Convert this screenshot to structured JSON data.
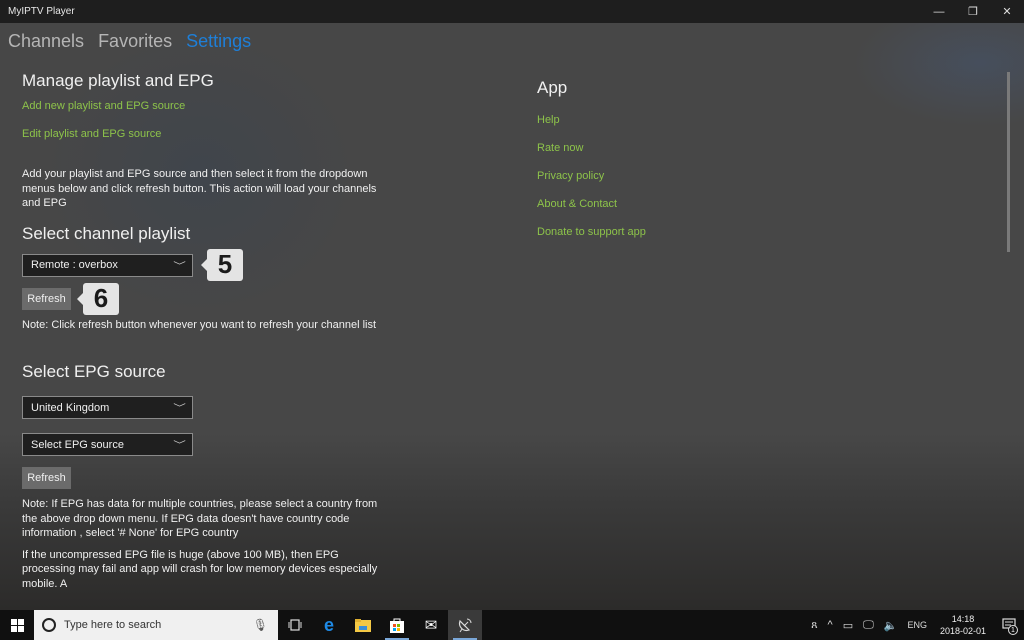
{
  "window": {
    "title": "MyIPTV Player",
    "controls": {
      "minimize": "—",
      "maximize": "❐",
      "close": "✕"
    }
  },
  "nav": {
    "tabs": [
      {
        "label": "Channels",
        "active": false
      },
      {
        "label": "Favorites",
        "active": false
      },
      {
        "label": "Settings",
        "active": true
      }
    ]
  },
  "manage": {
    "title": "Manage playlist and EPG",
    "links": [
      "Add new playlist and EPG source",
      "Edit playlist and EPG source"
    ],
    "description": "Add your playlist and EPG source and then select it from the dropdown menus below and click refresh button. This action will load your channels and EPG"
  },
  "channel_playlist": {
    "title": "Select channel playlist",
    "dropdown_value": "Remote : overbox",
    "refresh_label": "Refresh",
    "note": "Note: Click refresh button whenever you want to refresh your channel list",
    "callouts": [
      "5",
      "6"
    ]
  },
  "epg": {
    "title": "Select EPG source",
    "country_value": "United Kingdom",
    "source_value": "Select EPG source",
    "refresh_label": "Refresh",
    "note1": "Note:  If EPG has data for multiple countries, please select a country from the above drop down menu. If EPG  data doesn't have country code information , select '# None' for EPG country",
    "note2": "If the uncompressed EPG file is huge (above 100 MB), then EPG processing may fail and app will crash for low memory devices especially mobile. A"
  },
  "app": {
    "title": "App",
    "links": [
      "Help",
      "Rate now",
      "Privacy policy",
      "About & Contact",
      "Donate to support app"
    ]
  },
  "taskbar": {
    "search_placeholder": "Type here to search",
    "apps": [
      {
        "name": "task-view",
        "glyph": "▭"
      },
      {
        "name": "edge",
        "glyph": "e"
      },
      {
        "name": "file-explorer",
        "glyph": "▬"
      },
      {
        "name": "store",
        "glyph": "▣"
      },
      {
        "name": "mail",
        "glyph": "✉"
      },
      {
        "name": "myiptv",
        "glyph": "📡"
      }
    ],
    "tray": {
      "people": "ጸ",
      "chevron": "^",
      "battery": "▭",
      "network": "🖵",
      "volume": "🔈",
      "language": "ENG"
    },
    "time": "14:18",
    "date": "2018-02-01",
    "notification_count": "1"
  },
  "colors": {
    "accent_tab": "#1e7fd8",
    "link_green": "#8dc34a",
    "button_grey": "#6b6b6b"
  }
}
